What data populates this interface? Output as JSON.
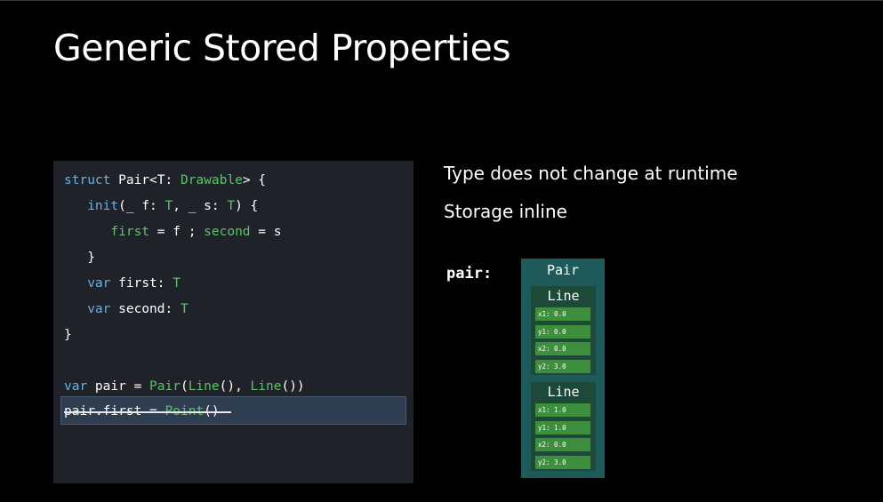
{
  "slide": {
    "title": "Generic Stored Properties"
  },
  "code": {
    "l1": {
      "kw": "struct",
      "name": " Pair<T: ",
      "type": "Drawable",
      "rest": "> {"
    },
    "l2": {
      "indent": "   ",
      "kw": "init",
      "a": "(_ f: ",
      "t1": "T",
      "b": ", _ s: ",
      "t2": "T",
      "c": ") {"
    },
    "l3": {
      "indent": "      ",
      "p1": "first",
      "a": " = f ; ",
      "p2": "second",
      "b": " = s"
    },
    "l4": {
      "text": "   }"
    },
    "l5": {
      "indent": "   ",
      "kw": "var",
      "name": " first: ",
      "type": "T"
    },
    "l6": {
      "indent": "   ",
      "kw": "var",
      "name": " second: ",
      "type": "T"
    },
    "l7": {
      "text": "}"
    },
    "l8": {
      "kw": "var",
      "name": " pair = ",
      "t1": "Pair",
      "a": "(",
      "t2": "Line",
      "b": "(), ",
      "t3": "Line",
      "c": "())"
    },
    "l9": {
      "plain": "pair.first = ",
      "type": "Point",
      "rest": "()"
    }
  },
  "bullets": [
    "Type does not change at runtime",
    "Storage inline"
  ],
  "diagram": {
    "var_label": "pair:",
    "outer_title": "Pair",
    "lines": [
      {
        "title": "Line",
        "fields": [
          "x1: 0.0",
          "y1: 0.0",
          "x2: 0.0",
          "y2: 3.0"
        ]
      },
      {
        "title": "Line",
        "fields": [
          "x1: 1.0",
          "y1: 1.0",
          "x2: 0.0",
          "y2: 3.0"
        ]
      }
    ]
  },
  "colors": {
    "background": "#000000",
    "code_panel": "#1f2229",
    "keyword": "#6cb0e0",
    "type": "#5ec26a",
    "pair_box": "#1e5a5a",
    "line_box": "#1d4a38",
    "field": "#3d8f3d"
  }
}
